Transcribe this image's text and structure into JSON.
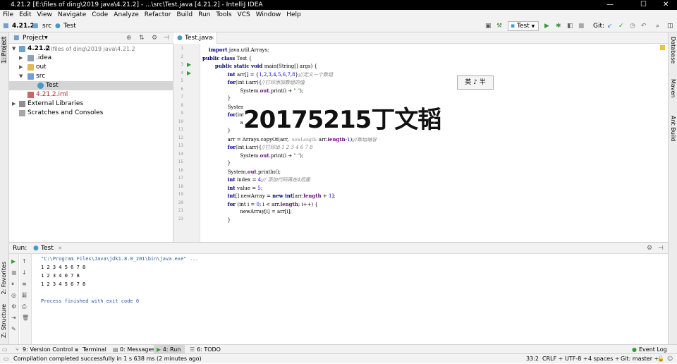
{
  "window": {
    "title": "4.21.2 [E:\\files of ding\\2019 java\\4.21.2] - ...\\src\\Test.java [4.21.2] - IntelliJ IDEA",
    "minimize": "—",
    "maximize": "☐",
    "close": "✕"
  },
  "menu": [
    "File",
    "Edit",
    "View",
    "Navigate",
    "Code",
    "Analyze",
    "Refactor",
    "Build",
    "Run",
    "Tools",
    "VCS",
    "Window",
    "Help"
  ],
  "breadcrumb": {
    "project": "4.21.2",
    "folder": "src",
    "file": "Test"
  },
  "toolbar": {
    "run_config": "Test",
    "git_label": "Git:"
  },
  "left_strip": {
    "project": "1: Project",
    "favorites": "2: Favorites",
    "structure": "Z: Structure"
  },
  "right_strip": {
    "database": "Database",
    "maven": "Maven",
    "ant": "Ant Build"
  },
  "project": {
    "header": "Project",
    "tree": [
      {
        "label": "4.21.2",
        "extra": "E:\\files of ding\\2019 java\\4.21.2"
      },
      {
        "label": ".idea"
      },
      {
        "label": "out"
      },
      {
        "label": "src"
      },
      {
        "label": "Test"
      },
      {
        "label": "4.21.2.iml"
      },
      {
        "label": "External Libraries"
      },
      {
        "label": "Scratches and Consoles"
      }
    ]
  },
  "editor": {
    "tab": "Test.java",
    "line_numbers": [
      "1",
      "2",
      "3",
      "4",
      "5",
      "6",
      "7",
      "8",
      "9",
      "10",
      "11",
      "12",
      "13",
      "14",
      "15",
      "16",
      "17",
      "18",
      "19",
      "20",
      "21",
      "22"
    ]
  },
  "overlay": {
    "watermark": "20175215丁文韬",
    "ime": "英 ♪ 半"
  },
  "run": {
    "label": "Run:",
    "tab": "Test",
    "console": [
      "\"C:\\Program Files\\Java\\jdk1.8.0_201\\bin\\java.exe\" ...",
      "1 2 3 4 5 6 7 8",
      "1 2 3 4 0 7 8",
      "1 2 3 4 5 6 7 8",
      "",
      "Process finished with exit code 0"
    ]
  },
  "bottom_tabs": [
    "9: Version Control",
    "Terminal",
    "0: Messages",
    "4: Run",
    "6: TODO"
  ],
  "event_log": "Event Log",
  "status": {
    "message": "Compilation completed successfully in 1 s 638 ms (2 minutes ago)",
    "position": "33:2",
    "line_sep": "CRLF ÷",
    "encoding": "UTF-8 ÷",
    "indent": "4 spaces ÷",
    "git": "Git: master ÷"
  }
}
